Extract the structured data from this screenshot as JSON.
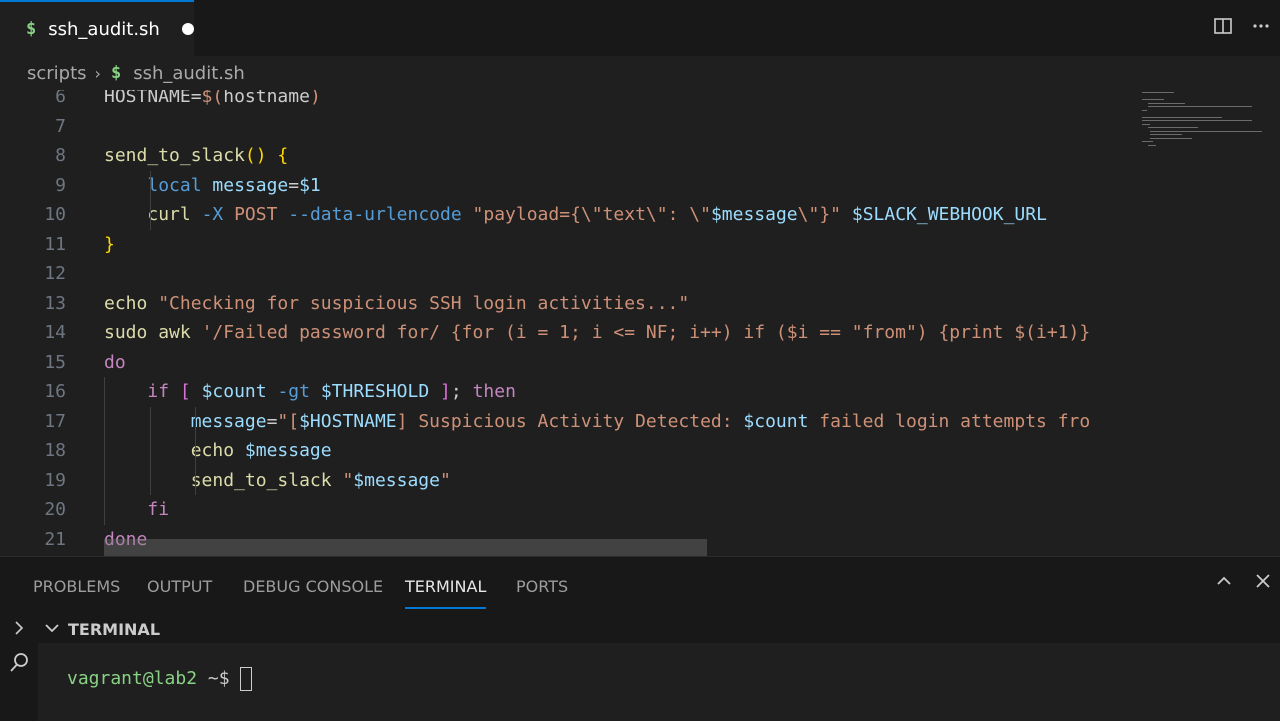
{
  "tab": {
    "icon": "$",
    "filename": "ssh_audit.sh"
  },
  "breadcrumb": {
    "folder": "scripts",
    "icon": "$",
    "file": "ssh_audit.sh"
  },
  "editor": {
    "lines": [
      {
        "n": "6",
        "html": "HOSTNAME=<span class='s'>$(</span>hostname<span class='s'>)</span>"
      },
      {
        "n": "7",
        "html": ""
      },
      {
        "n": "8",
        "html": "<span class='f'>send_to_slack</span><span class='p'>()</span> <span class='p'>{</span>"
      },
      {
        "n": "9",
        "html": "    <span class='k'>local</span> <span class='v'>message</span>=<span class='v'>$1</span>"
      },
      {
        "n": "10",
        "html": "    <span class='f'>curl</span> <span class='k'>-X</span> <span class='s'>POST</span> <span class='k'>--data-urlencode</span> <span class='s'>\"payload={\\\"text\\\": \\\"</span><span class='v'>$message</span><span class='s'>\\\"}\"</span> <span class='v'>$SLACK_WEBHOOK_URL</span>"
      },
      {
        "n": "11",
        "html": "<span class='p'>}</span>"
      },
      {
        "n": "12",
        "html": ""
      },
      {
        "n": "13",
        "html": "<span class='f'>echo</span> <span class='s'>\"Checking for suspicious SSH login activities...\"</span>"
      },
      {
        "n": "14",
        "html": "<span class='f'>sudo</span> <span class='f'>awk</span> <span class='s'>'/Failed password for/ {for (i = 1; i &lt;= NF; i++) if ($i == \"from\") {print $(i+1)}</span>"
      },
      {
        "n": "15",
        "html": "<span class='c'>do</span>"
      },
      {
        "n": "16",
        "html": "    <span class='c'>if</span> <span class='pu'>[</span> <span class='v'>$count</span> <span class='k'>-gt</span> <span class='v'>$THRESHOLD</span> <span class='pu'>]</span>; <span class='c'>then</span>"
      },
      {
        "n": "17",
        "html": "        <span class='v'>message</span>=<span class='s'>\"[</span><span class='v'>$HOSTNAME</span><span class='s'>] Suspicious Activity Detected: </span><span class='v'>$count</span><span class='s'> failed login attempts fro</span>"
      },
      {
        "n": "18",
        "html": "        <span class='f'>echo</span> <span class='v'>$message</span>"
      },
      {
        "n": "19",
        "html": "        <span class='f'>send_to_slack</span> <span class='s'>\"</span><span class='v'>$message</span><span class='s'>\"</span>"
      },
      {
        "n": "20",
        "html": "    <span class='c'>fi</span>"
      },
      {
        "n": "21",
        "html": "<span class='c'>done</span>"
      }
    ]
  },
  "panel": {
    "tabs": [
      "PROBLEMS",
      "OUTPUT",
      "DEBUG CONSOLE",
      "TERMINAL",
      "PORTS"
    ],
    "active_tab": "TERMINAL",
    "terminal_title": "TERMINAL",
    "prompt_user": "vagrant@lab2",
    "prompt_path": " ~$"
  },
  "colors": {
    "accent": "#0078d4",
    "modified_dot": "#ffffff",
    "shell_icon": "#89d185"
  }
}
